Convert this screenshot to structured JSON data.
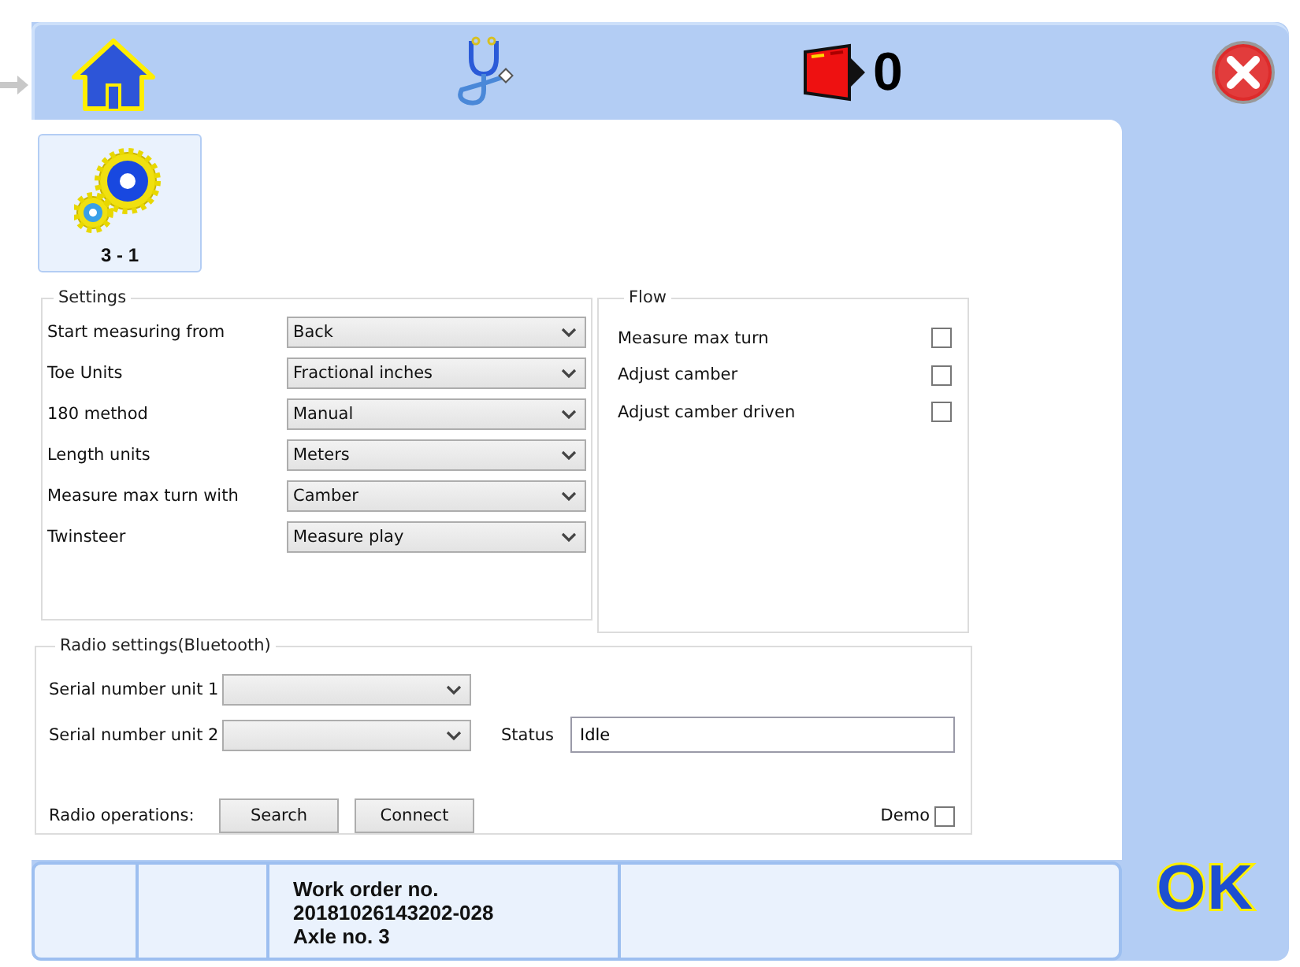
{
  "toolbar": {
    "counter": "0"
  },
  "tile": {
    "label": "3 - 1",
    "selected": true
  },
  "settings": {
    "title": "Settings",
    "rows": [
      {
        "label": "Start measuring from",
        "value": "Back"
      },
      {
        "label": "Toe Units",
        "value": "Fractional inches"
      },
      {
        "label": "180 method",
        "value": "Manual"
      },
      {
        "label": "Length units",
        "value": "Meters"
      },
      {
        "label": "Measure max turn with",
        "value": "Camber"
      },
      {
        "label": "Twinsteer",
        "value": "Measure play"
      }
    ]
  },
  "flow": {
    "title": "Flow",
    "options": [
      {
        "label": "Measure max turn",
        "checked": false
      },
      {
        "label": "Adjust camber",
        "checked": false
      },
      {
        "label": "Adjust camber driven",
        "checked": false
      }
    ]
  },
  "radio": {
    "title": "Radio settings(Bluetooth)",
    "serials": [
      {
        "label": "Serial number unit 1"
      },
      {
        "label": "Serial number unit 2"
      }
    ],
    "status_label": "Status",
    "status_value": "Idle",
    "operations_label": "Radio operations:",
    "buttons": [
      "Search",
      "Connect"
    ],
    "demo": {
      "label": "Demo",
      "checked": false
    }
  },
  "status_bar": {
    "info_lines": [
      "Work order no.",
      "20181026143202-028",
      "Axle no. 3"
    ]
  },
  "ok_button": "OK"
}
